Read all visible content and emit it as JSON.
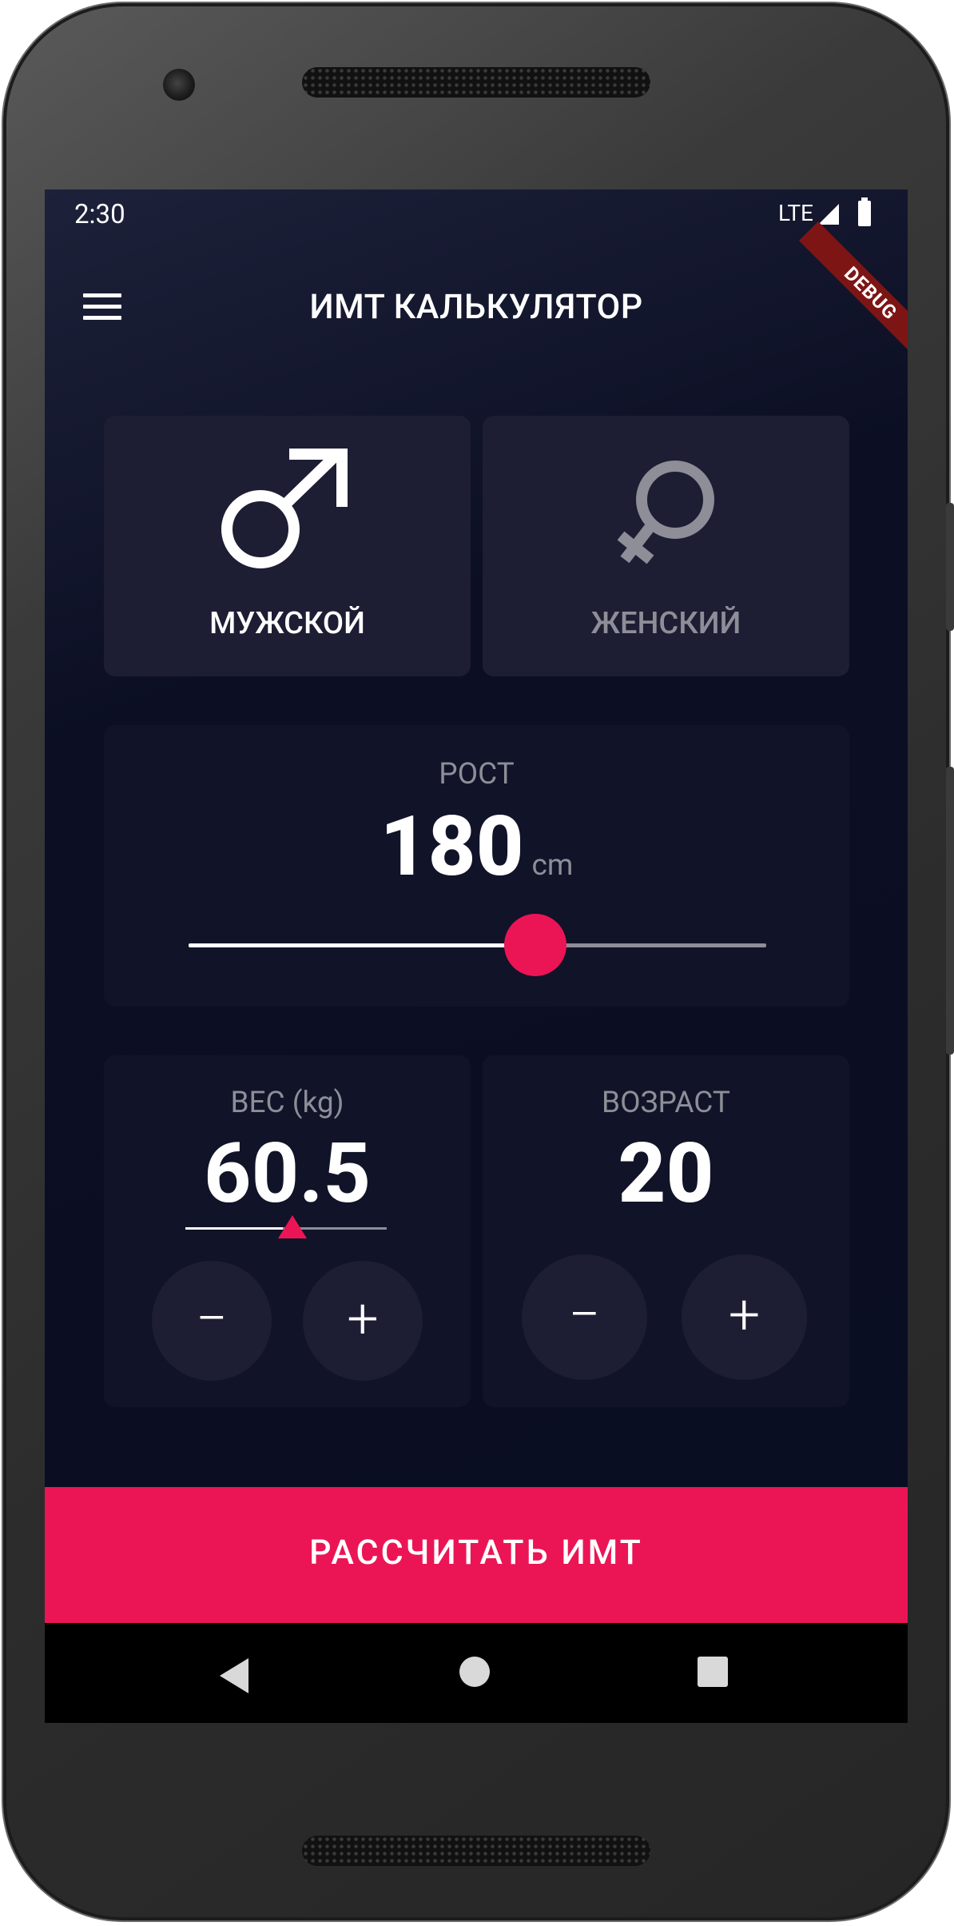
{
  "status_bar": {
    "time": "2:30",
    "network": "LTE",
    "debug_banner": "DEBUG"
  },
  "app_bar": {
    "title": "ИМТ КАЛЬКУЛЯТОР",
    "menu_icon": "hamburger-menu-icon"
  },
  "gender": {
    "male": {
      "label": "МУЖСКОЙ",
      "icon": "male-symbol-icon",
      "selected": true
    },
    "female": {
      "label": "ЖЕНСКИЙ",
      "icon": "female-symbol-icon",
      "selected": false
    }
  },
  "height": {
    "label": "РОСТ",
    "value": "180",
    "unit": "cm",
    "slider_fraction": 0.6
  },
  "weight": {
    "label": "ВЕС (kg)",
    "value": "60.5",
    "minus_label": "−",
    "plus_label": "+"
  },
  "age": {
    "label": "ВОЗРАСТ",
    "value": "20",
    "minus_label": "−",
    "plus_label": "+"
  },
  "calculate_button": {
    "label": "РАССЧИТАТЬ ИМТ"
  },
  "colors": {
    "accent": "#EB1555",
    "active_card": "#1D1E33",
    "inactive_card": "#111328",
    "background": "#0A0D21",
    "muted_text": "#8D8E98"
  }
}
